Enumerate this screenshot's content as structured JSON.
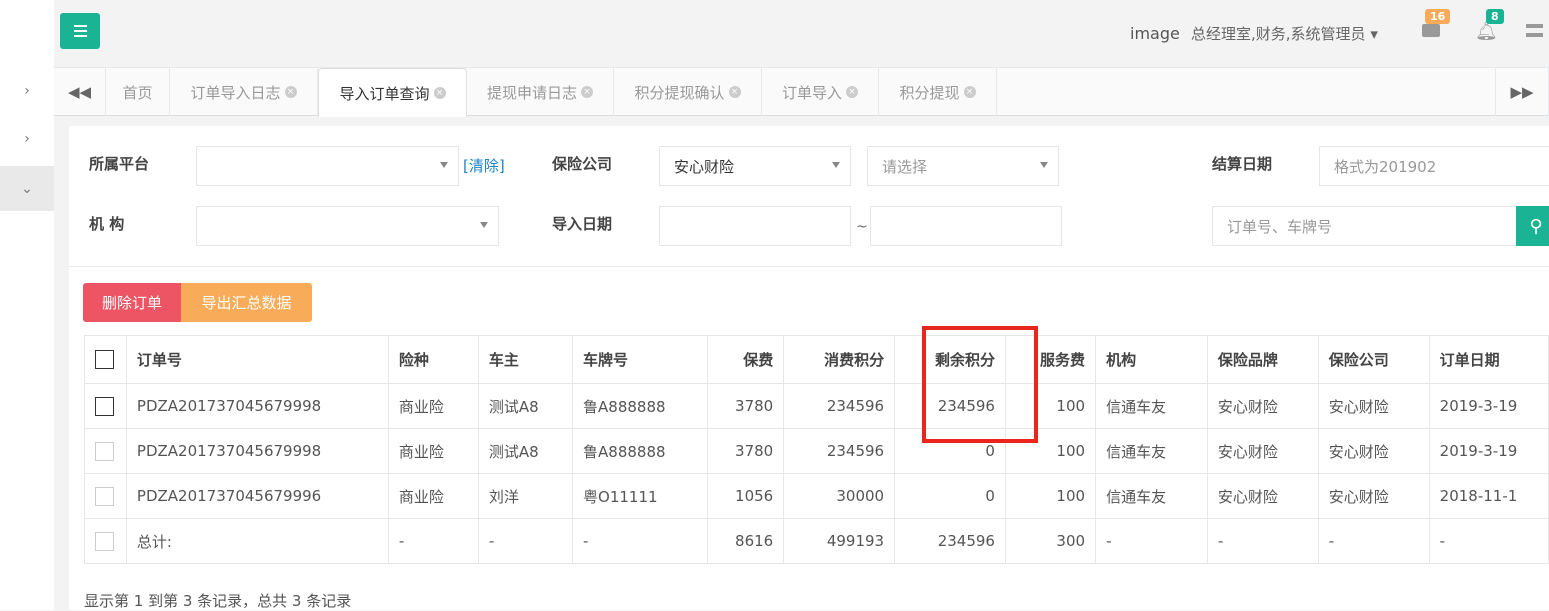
{
  "header": {
    "user": "image",
    "roles": "总经理室,财务,系统管理员",
    "mail_count": "16",
    "bell_count": "8"
  },
  "colors": {
    "accent": "#1ab394",
    "danger": "#ed5565",
    "warning": "#f8ac59",
    "highlight": "#e8261c"
  },
  "tabs": [
    {
      "label": "首页",
      "closable": false
    },
    {
      "label": "订单导入日志",
      "closable": true
    },
    {
      "label": "导入订单查询",
      "closable": true,
      "active": true
    },
    {
      "label": "提现申请日志",
      "closable": true
    },
    {
      "label": "积分提现确认",
      "closable": true
    },
    {
      "label": "订单导入",
      "closable": true
    },
    {
      "label": "积分提现",
      "closable": true
    }
  ],
  "filters": {
    "platform_label": "所属平台",
    "platform_value": "",
    "clear": "[清除]",
    "insurer_label": "保险公司",
    "insurer_value": "安心财险",
    "sub_placeholder": "请选择",
    "settle_label": "结算日期",
    "settle_placeholder": "格式为201902",
    "org_label": "机 构",
    "import_label": "导入日期",
    "tilde": "~",
    "search_placeholder": "订单号、车牌号"
  },
  "actions": {
    "delete": "删除订单",
    "export": "导出汇总数据"
  },
  "table": {
    "headers": [
      "订单号",
      "险种",
      "车主",
      "车牌号",
      "保费",
      "消费积分",
      "剩余积分",
      "服务费",
      "机构",
      "保险品牌",
      "保险公司",
      "订单日期"
    ],
    "rows": [
      [
        "PDZA201737045679998",
        "商业险",
        "测试A8",
        "鲁A888888",
        "3780",
        "234596",
        "234596",
        "100",
        "信通车友",
        "安心财险",
        "安心财险",
        "2019-3-19"
      ],
      [
        "PDZA201737045679998",
        "商业险",
        "测试A8",
        "鲁A888888",
        "3780",
        "234596",
        "0",
        "100",
        "信通车友",
        "安心财险",
        "安心财险",
        "2019-3-19"
      ],
      [
        "PDZA201737045679996",
        "商业险",
        "刘洋",
        "粤O11111",
        "1056",
        "30000",
        "0",
        "100",
        "信通车友",
        "安心财险",
        "安心财险",
        "2018-11-1"
      ],
      [
        "总计:",
        "-",
        "-",
        "-",
        "8616",
        "499193",
        "234596",
        "300",
        "-",
        "-",
        "-",
        "-"
      ]
    ]
  },
  "footer": "显示第 1 到第 3 条记录，总共 3 条记录"
}
